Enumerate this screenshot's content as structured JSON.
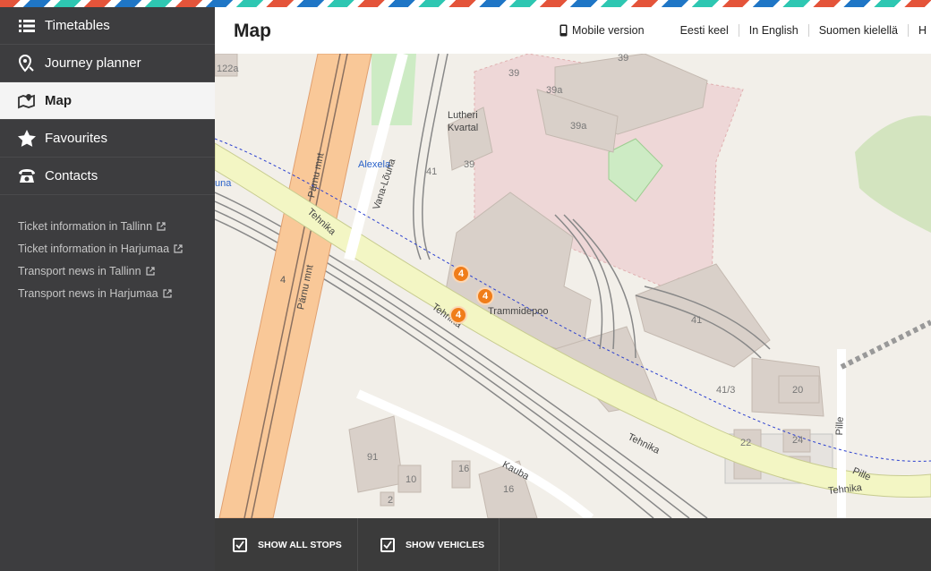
{
  "sidebar": {
    "items": [
      {
        "label": "Timetables",
        "icon": "list-icon",
        "active": false
      },
      {
        "label": "Journey planner",
        "icon": "route-pin-icon",
        "active": false
      },
      {
        "label": "Map",
        "icon": "map-icon",
        "active": true
      },
      {
        "label": "Favourites",
        "icon": "star-icon",
        "active": false
      },
      {
        "label": "Contacts",
        "icon": "phone-icon",
        "active": false
      }
    ],
    "links": [
      {
        "label": "Ticket information in Tallinn",
        "icon": "external-link-icon"
      },
      {
        "label": "Ticket information in Harjumaa",
        "icon": "external-link-icon"
      },
      {
        "label": "Transport news in Tallinn",
        "icon": "external-link-icon"
      },
      {
        "label": "Transport news in Harjumaa",
        "icon": "external-link-icon"
      }
    ]
  },
  "header": {
    "title": "Map",
    "mobile_label": "Mobile version",
    "languages": [
      "Eesti keel",
      "In English",
      "Suomen kielellä",
      "H"
    ]
  },
  "map": {
    "labels": {
      "lutheri": "Lutheri",
      "kvartal": "Kvartal",
      "trammidepoo": "Trammidepoo",
      "alexela": "Alexela",
      "vana_louna": "Vana-Lõuna",
      "parnu1": "Pärnu mnt",
      "parnu2": "Pärnu mnt",
      "tehnika1": "Tehnika",
      "tehnika2": "Tehnika",
      "tehnika3": "Tehnika",
      "tehnika4": "Tehnika",
      "kauba": "Kauba",
      "pille1": "Pille",
      "pille2": "Pille",
      "luna": "una",
      "n122a": "122a",
      "n39a": "39",
      "n39b": "39",
      "n39c": "39a",
      "n39d": "39a",
      "n39e": "39",
      "n41a": "41",
      "n41b": "41",
      "n413": "41/3",
      "n20": "20",
      "n22": "22",
      "n24": "24",
      "n91": "91",
      "n10": "10",
      "n16a": "16",
      "n16b": "16",
      "n2": "2",
      "n4": "4"
    },
    "stop_badges": [
      "4",
      "4",
      "4"
    ]
  },
  "bottom": {
    "show_all_stops": {
      "label": "SHOW ALL STOPS",
      "checked": true
    },
    "show_vehicles": {
      "label": "SHOW VEHICLES",
      "checked": true
    }
  },
  "colors": {
    "sidebar_bg": "#3d3d3f",
    "stop_badge": "#f07d1a",
    "road_major": "#f9c898",
    "road_secondary": "#f3f6c4"
  }
}
